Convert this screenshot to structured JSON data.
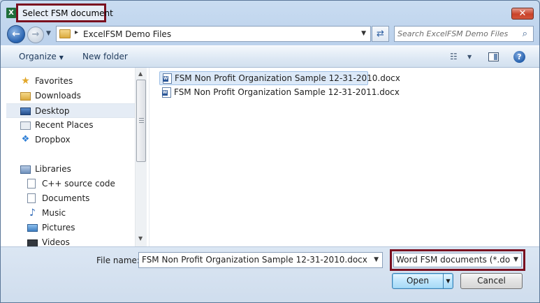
{
  "window": {
    "app_icon": "X",
    "title": "Select FSM document",
    "close_label": "✕"
  },
  "address_bar": {
    "back_icon": "←",
    "forward_icon": "→",
    "separator": "▸",
    "path": "ExcelFSM Demo Files",
    "refresh_icon": "⇄"
  },
  "search": {
    "placeholder": "Search ExcelFSM Demo Files",
    "icon": "⌕"
  },
  "toolbar": {
    "organize_label": "Organize",
    "new_folder_label": "New folder",
    "views_icon": "☷",
    "help_icon": "?"
  },
  "navigation": {
    "items": [
      {
        "label": "Favorites",
        "icon": "star-icon",
        "glyph": "★"
      },
      {
        "label": "Downloads",
        "icon": "folder-icon",
        "glyph": ""
      },
      {
        "label": "Desktop",
        "icon": "desktop-icon",
        "glyph": "",
        "selected": true
      },
      {
        "label": "Recent Places",
        "icon": "recent-places-icon",
        "glyph": ""
      },
      {
        "label": "Dropbox",
        "icon": "dropbox-icon",
        "glyph": "❖"
      },
      {
        "label": "Libraries",
        "icon": "libraries-icon",
        "glyph": ""
      },
      {
        "label": "C++ source code",
        "icon": "document-icon",
        "glyph": ""
      },
      {
        "label": "Documents",
        "icon": "document-icon",
        "glyph": ""
      },
      {
        "label": "Music",
        "icon": "music-icon",
        "glyph": "♪"
      },
      {
        "label": "Pictures",
        "icon": "pictures-icon",
        "glyph": ""
      },
      {
        "label": "Videos",
        "icon": "videos-icon",
        "glyph": ""
      }
    ]
  },
  "files": [
    {
      "name": "FSM Non Profit Organization Sample 12-31-2010.docx",
      "selected": true
    },
    {
      "name": "FSM Non Profit Organization Sample 12-31-2011.docx",
      "selected": false
    }
  ],
  "bottom": {
    "file_name_label": "File name:",
    "file_name_value": "FSM Non Profit Organization Sample 12-31-2010.docx",
    "file_type_value": "Word FSM documents (*.docx;*",
    "open_label": "Open",
    "cancel_label": "Cancel"
  },
  "colors": {
    "highlight_border": "#7a1020",
    "selection": "#dce9f8"
  }
}
